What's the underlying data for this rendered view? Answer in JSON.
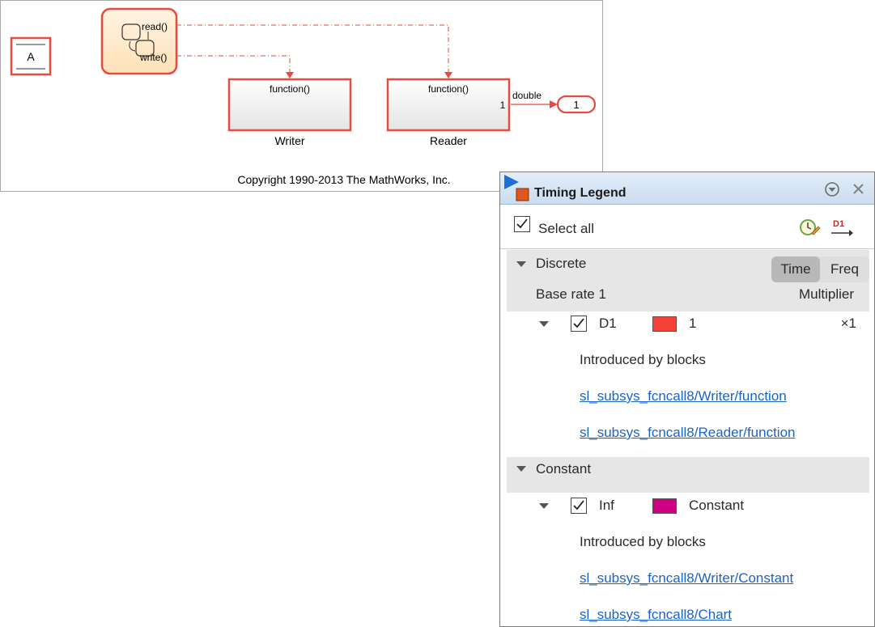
{
  "diagram": {
    "goto_block": "A",
    "chart": {
      "read_label": "read()",
      "write_label": "write()"
    },
    "writer": {
      "port_label": "function()",
      "name": "Writer"
    },
    "reader": {
      "port_label": "function()",
      "name": "Reader",
      "out_port": "1"
    },
    "signal_label": "double",
    "outport_label": "1",
    "copyright": "Copyright 1990-2013 The MathWorks, Inc.",
    "colors": {
      "block_border": "#e84a3e",
      "sample_d1": "#f44336",
      "sample_const": "#cc0080",
      "signal": "#e84a3e"
    }
  },
  "legend": {
    "title": "Timing Legend",
    "select_all": "Select all",
    "select_all_checked": true,
    "icons": {
      "title": "timing-legend-icon",
      "menu": "chevron-down-circle-icon",
      "close": "close-icon",
      "highlight": "clock-highlight-icon",
      "trace": "d1-trace-icon"
    },
    "trace_label": "D1",
    "discrete": {
      "header": "Discrete",
      "toggle": {
        "time": "Time",
        "freq": "Freq",
        "selected": "Time"
      },
      "base_rate": "Base rate 1",
      "multiplier_header": "Multiplier",
      "rate": {
        "name": "D1",
        "value": "1",
        "multiplier": "×1",
        "introduced_label": "Introduced by blocks",
        "blocks": [
          "sl_subsys_fcncall8/Writer/function",
          "sl_subsys_fcncall8/Reader/function"
        ]
      }
    },
    "constant": {
      "header": "Constant",
      "rate": {
        "name": "Inf",
        "value": "Constant",
        "introduced_label": "Introduced by blocks",
        "blocks": [
          "sl_subsys_fcncall8/Writer/Constant",
          "sl_subsys_fcncall8/Chart"
        ]
      }
    }
  }
}
